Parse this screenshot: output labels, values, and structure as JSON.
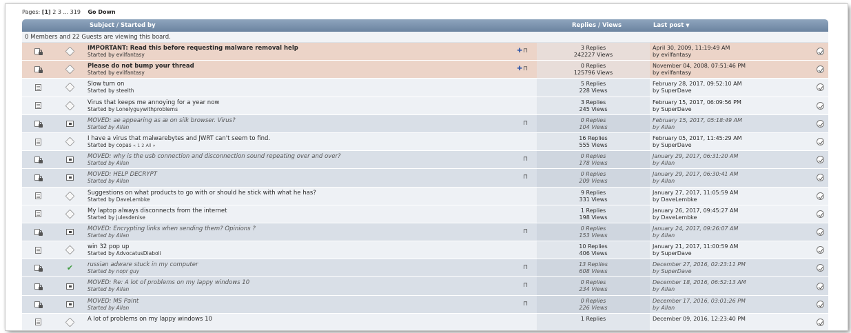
{
  "pagination": {
    "label": "Pages:",
    "current": "[1]",
    "others": "2 3 ... 319",
    "go_down": "Go Down"
  },
  "header": {
    "subject": "Subject / Started by",
    "replies_views": "Replies / Views",
    "last_post": "Last post",
    "sort_icon": "caret-down-icon"
  },
  "viewing": "0 Members and 22 Guests are viewing this board.",
  "colors": {
    "header": "#7a91ab",
    "sticky_row": "#ecd4c8",
    "normal_row": "#eef1f5",
    "moved_row": "#d9dfe7"
  },
  "topics": [
    {
      "kind": "sticky",
      "icon": "hot-locked-topic-icon",
      "status_icon": "tag-icon",
      "title": "IMPORTANT: Read this before requesting malware removal help",
      "started": "Started by evilfantasy",
      "flags": "pin-lock",
      "replies": "3 Replies",
      "views": "242227 Views",
      "date": "April 30, 2009, 11:19:49 AM",
      "by": "by evilfantasy"
    },
    {
      "kind": "sticky",
      "icon": "hot-locked-topic-icon",
      "status_icon": "tag-icon",
      "title": "Please do not bump your thread",
      "started": "Started by evilfantasy",
      "flags": "pin-lock",
      "replies": "0 Replies",
      "views": "125796 Views",
      "date": "November 04, 2008, 07:51:46 PM",
      "by": "by evilfantasy"
    },
    {
      "kind": "normal",
      "icon": "topic-icon",
      "status_icon": "tag-icon",
      "title": "Slow turn on",
      "started": "Started by steelth",
      "replies": "5 Replies",
      "views": "228 Views",
      "date": "February 28, 2017, 09:52:10 AM",
      "by": "by SuperDave"
    },
    {
      "kind": "normal",
      "icon": "topic-icon",
      "status_icon": "tag-icon",
      "title": "Virus that keeps me annoying for a year now",
      "started": "Started by Lonelyguywithproblems",
      "replies": "3 Replies",
      "views": "245 Views",
      "date": "February 15, 2017, 06:09:56 PM",
      "by": "by SuperDave"
    },
    {
      "kind": "moved",
      "icon": "locked-topic-icon",
      "status_icon": "moved-icon",
      "title": "MOVED: ae appearing as æ on silk browser. Virus?",
      "started": "Started by Allan",
      "flags": "lock",
      "replies": "0 Replies",
      "views": "104 Views",
      "date": "February 15, 2017, 05:18:49 AM",
      "by": "by Allan"
    },
    {
      "kind": "normal",
      "icon": "topic-icon",
      "status_icon": "tag-icon",
      "title": "I have a virus that malwarebytes and JWRT can't seem to find.",
      "started": "Started by copas",
      "pages": "« 1 2  All »",
      "replies": "16 Replies",
      "views": "555 Views",
      "date": "February 05, 2017, 11:45:29 AM",
      "by": "by SuperDave"
    },
    {
      "kind": "moved",
      "icon": "locked-topic-icon",
      "status_icon": "moved-icon",
      "title": "MOVED: why is the usb connection and disconnection sound repeating over and over?",
      "started": "Started by Allan",
      "flags": "lock",
      "replies": "0 Replies",
      "views": "178 Views",
      "date": "January 29, 2017, 06:31:20 AM",
      "by": "by Allan"
    },
    {
      "kind": "moved",
      "icon": "locked-topic-icon",
      "status_icon": "moved-icon",
      "title": "MOVED: HELP DECRYPT",
      "started": "Started by Allan",
      "flags": "lock",
      "replies": "0 Replies",
      "views": "209 Views",
      "date": "January 29, 2017, 06:30:41 AM",
      "by": "by Allan"
    },
    {
      "kind": "normal",
      "icon": "topic-icon",
      "status_icon": "tag-icon",
      "title": "Suggestions on what products to go with or should he stick with what he has?",
      "started": "Started by DaveLembke",
      "replies": "9 Replies",
      "views": "331 Views",
      "date": "January 27, 2017, 11:05:59 AM",
      "by": "by DaveLembke"
    },
    {
      "kind": "normal",
      "icon": "topic-icon",
      "status_icon": "tag-icon",
      "title": "My laptop always disconnects from the internet",
      "started": "Started by julesdenise",
      "replies": "1 Replies",
      "views": "198 Views",
      "date": "January 26, 2017, 09:45:27 AM",
      "by": "by DaveLembke"
    },
    {
      "kind": "moved",
      "icon": "locked-topic-icon",
      "status_icon": "moved-icon",
      "title": "MOVED: Encrypting links when sending them? Opinions ?",
      "started": "Started by Allan",
      "flags": "lock",
      "replies": "0 Replies",
      "views": "153 Views",
      "date": "January 24, 2017, 09:26:07 AM",
      "by": "by Allan"
    },
    {
      "kind": "normal",
      "icon": "topic-icon",
      "status_icon": "tag-icon",
      "title": "win 32 pop up",
      "started": "Started by AdvocatusDiaboli",
      "replies": "10 Replies",
      "views": "406 Views",
      "date": "January 21, 2017, 11:00:59 AM",
      "by": "by SuperDave"
    },
    {
      "kind": "moved",
      "icon": "locked-topic-icon",
      "status_icon": "check-icon",
      "title": "russian adware stuck in my computer",
      "started": "Started by nopr guy",
      "flags": "lock",
      "replies": "13 Replies",
      "views": "608 Views",
      "date": "December 27, 2016, 02:23:11 PM",
      "by": "by SuperDave"
    },
    {
      "kind": "moved",
      "icon": "locked-topic-icon",
      "status_icon": "moved-icon",
      "title": "MOVED: Re: A lot of problems on my lappy windows 10",
      "started": "Started by Allan",
      "flags": "lock",
      "replies": "0 Replies",
      "views": "234 Views",
      "date": "December 18, 2016, 06:52:13 AM",
      "by": "by Allan"
    },
    {
      "kind": "moved",
      "icon": "locked-topic-icon",
      "status_icon": "moved-icon",
      "title": "MOVED: MS Paint",
      "started": "Started by Allan",
      "flags": "lock",
      "replies": "0 Replies",
      "views": "226 Views",
      "date": "December 17, 2016, 03:01:26 PM",
      "by": "by Allan"
    },
    {
      "kind": "normal",
      "icon": "topic-icon",
      "status_icon": "tag-icon",
      "title": "A lot of problems on my lappy windows 10",
      "started": "",
      "replies": "1 Replies",
      "views": "",
      "date": "December 09, 2016, 12:23:40 PM",
      "by": ""
    }
  ]
}
